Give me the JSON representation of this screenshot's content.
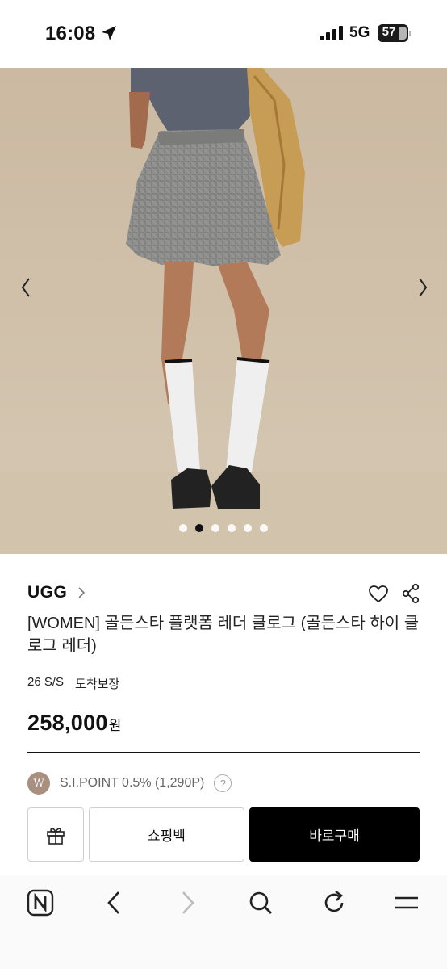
{
  "status_bar": {
    "time": "16:08",
    "network": "5G",
    "battery": "57"
  },
  "gallery": {
    "slide_count": 6,
    "active_index": 1
  },
  "product": {
    "brand": "UGG",
    "title": "[WOMEN] 골든스타 플랫폼 레더 클로그 (골든스타 하이 클로그 레더)",
    "season": "26 S/S",
    "delivery_badge": "도착보장",
    "price": "258,000",
    "currency": "원",
    "point_badge": "W",
    "point_text": "S.I.POINT 0.5% (1,290P)",
    "help": "?"
  },
  "actions": {
    "cart_label": "쇼핑백",
    "buy_label": "바로구매"
  },
  "colors": {
    "buy_button": "#000000",
    "point_badge": "#a88f80",
    "backdrop": "#cdbda6"
  },
  "icons": [
    "location-icon",
    "signal-icon",
    "battery-icon",
    "chevron-left-icon",
    "chevron-right-icon",
    "heart-icon",
    "share-icon",
    "gift-icon",
    "naver-icon",
    "back-icon",
    "forward-icon",
    "search-icon",
    "reload-icon",
    "menu-icon"
  ]
}
